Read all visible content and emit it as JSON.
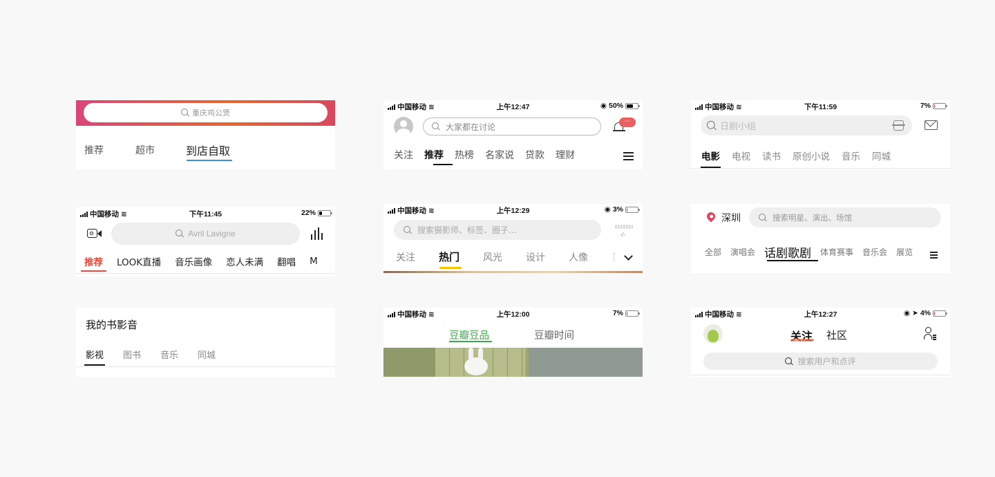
{
  "carrier": "中国移动",
  "card1": {
    "search_placeholder": "重庆鸡公煲",
    "tabs": [
      "推荐",
      "超市",
      "到店自取"
    ]
  },
  "card2": {
    "time": "上午12:47",
    "battery": "50%",
    "battery_level": 0.5,
    "search_placeholder": "大家都在讨论",
    "notif_badge": "···",
    "tabs": [
      "关注",
      "推荐",
      "热榜",
      "名家说",
      "贷款",
      "理财"
    ]
  },
  "card3": {
    "time": "下午11:59",
    "battery": "7%",
    "battery_level": 0.07,
    "search_placeholder": "日剧小组",
    "tabs": [
      "电影",
      "电视",
      "读书",
      "原创小说",
      "音乐",
      "同城"
    ]
  },
  "card4": {
    "time": "下午11:45",
    "battery": "22%",
    "battery_level": 0.22,
    "search_placeholder": "Avril Lavigne",
    "tabs": [
      "推荐",
      "LOOK直播",
      "音乐画像",
      "恋人未满",
      "翻唱",
      "M"
    ]
  },
  "card5": {
    "time": "上午12:29",
    "battery": "3%",
    "battery_level": 0.03,
    "search_placeholder": "搜索摄影师、标签、圈子...",
    "side_label": "-/-",
    "tabs": [
      "关注",
      "热门",
      "风光",
      "设计",
      "人像"
    ]
  },
  "card6": {
    "city": "深圳",
    "search_placeholder": "搜索明星、演出、场馆",
    "tabs": [
      "全部",
      "演唱会",
      "话剧歌剧",
      "体育赛事",
      "音乐会",
      "展览"
    ]
  },
  "card7": {
    "title": "我的书影音",
    "tabs": [
      "影视",
      "图书",
      "音乐",
      "同城"
    ]
  },
  "card8": {
    "time": "上午12:00",
    "battery": "7%",
    "battery_level": 0.07,
    "tabs": [
      "豆瓣豆品",
      "豆瓣时间"
    ]
  },
  "card9": {
    "time": "上午12:27",
    "battery": "4%",
    "battery_level": 0.04,
    "tabs": [
      "关注",
      "社区"
    ],
    "search_placeholder": "搜索用户和点评"
  },
  "colors": {
    "accent_red": "#e84a3c",
    "accent_green": "#3ea84a",
    "accent_yellow": "#f5c400",
    "accent_blue": "#2f8ee0"
  },
  "icons": [
    "search-icon",
    "wifi-icon",
    "bell-icon",
    "menu-icon",
    "camera-icon",
    "equalizer-icon",
    "scan-icon",
    "mail-icon",
    "location-pin-icon",
    "avatar-icon",
    "user-list-icon",
    "chevron-down-icon"
  ]
}
